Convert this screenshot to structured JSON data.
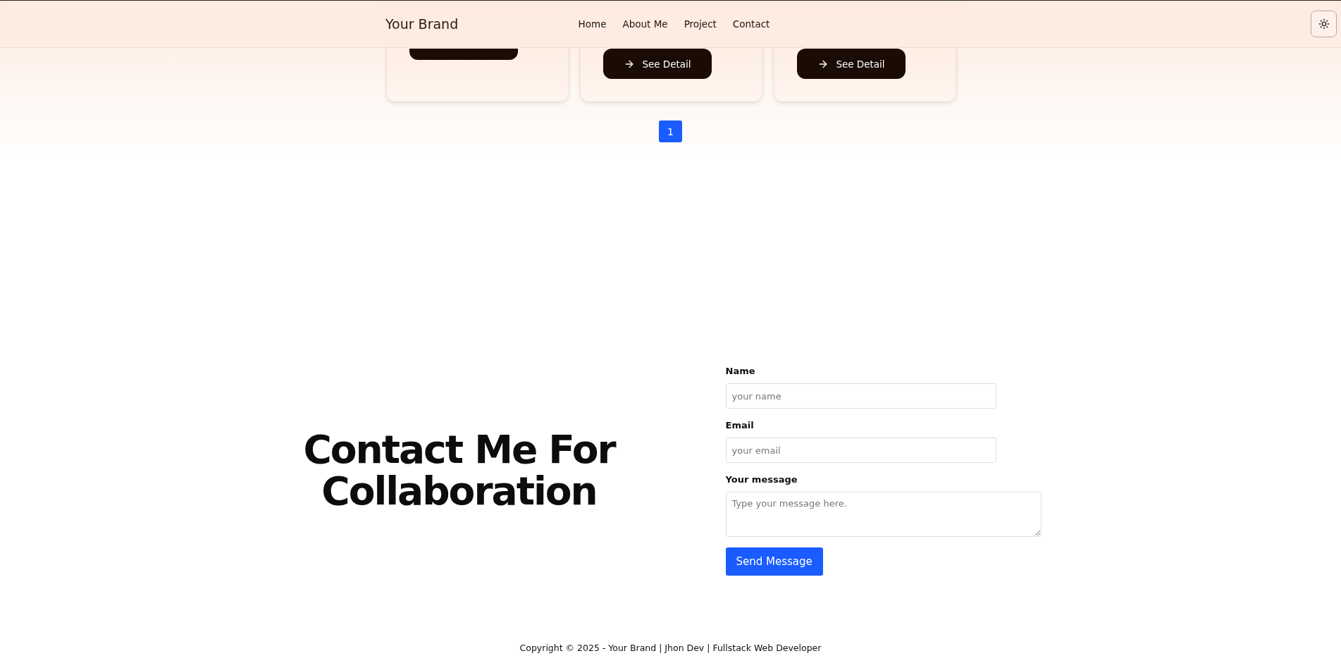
{
  "header": {
    "brand": "Your Brand",
    "nav": [
      {
        "label": "Home"
      },
      {
        "label": "About Me"
      },
      {
        "label": "Project"
      },
      {
        "label": "Contact"
      }
    ]
  },
  "cards": [
    {
      "kind": "obscured"
    },
    {
      "kind": "detail",
      "button": "See Detail"
    },
    {
      "kind": "detail",
      "button": "See Detail"
    }
  ],
  "pagination": [
    {
      "label": "1",
      "selected": true
    }
  ],
  "contact": {
    "heading": "Contact Me For Collaboration",
    "fields": [
      {
        "kind": "input",
        "label": "Name",
        "placeholder": "your name"
      },
      {
        "kind": "input",
        "label": "Email",
        "placeholder": "your email"
      },
      {
        "kind": "textarea",
        "label": "Your message",
        "placeholder": "Type your message here."
      }
    ],
    "submit": "Send Message"
  },
  "footer": "Copyright © 2025 - Your Brand | Jhon Dev | Fullstack Web Developer"
}
